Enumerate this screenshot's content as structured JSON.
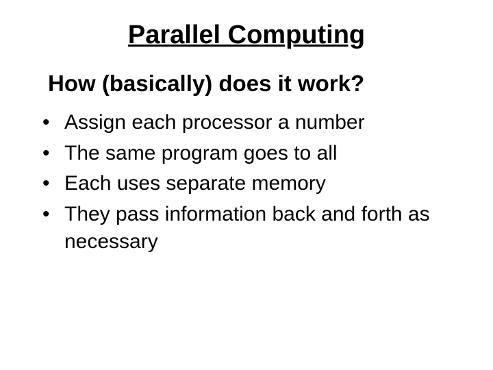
{
  "title": "Parallel Computing",
  "subtitle": "How (basically) does it work?",
  "bullets": [
    "Assign each processor a number",
    "The same program goes to all",
    "Each uses separate memory",
    "They pass information back and forth as necessary"
  ]
}
